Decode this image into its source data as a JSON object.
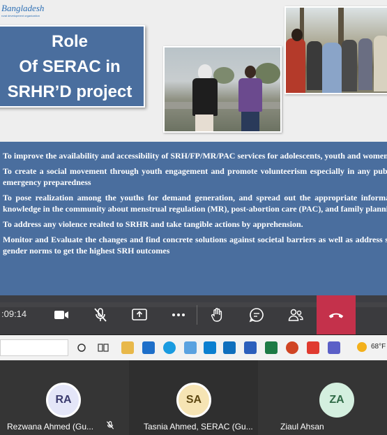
{
  "slide": {
    "logo_text": "Bangladesh",
    "logo_subtext": "rural development organization",
    "title_lines": [
      "Role",
      "Of SERAC in",
      "SRHR’D project"
    ],
    "bullets": [
      "To improve the availability and accessibility of SRH/FP/MR/PAC services for adolescents, youth and women",
      "To create a social movement through youth engagement and promote volunteerism especially in any public health emergency preparedness",
      "To pose realization among the youths for demand generation, and spread out the appropriate information and knowledge in the community about menstrual regulation (MR), post-abortion care (PAC), and family planning (FP)",
      "To address any violence realted to SRHR and take tangible actions by apprehension.",
      "Monitor and Evaluate the changes and find concrete solutions against societal barriers as well as address social and gender norms to get the highest SRH outcomes"
    ]
  },
  "controls": {
    "timer": ":09:14",
    "buttons": [
      "camera-icon",
      "mic-muted-icon",
      "share-icon",
      "more-icon",
      "raise-hand-icon",
      "chat-icon",
      "participants-icon",
      "hang-up-icon"
    ],
    "hangup_color": "#c4314b"
  },
  "taskbar": {
    "temperature": "68°F"
  },
  "participants": [
    {
      "initials": "RA",
      "name": "Rezwana Ahmed (Gu...",
      "muted": true
    },
    {
      "initials": "SA",
      "name": "Tasnia Ahmed, SERAC (Gu...",
      "muted": false
    },
    {
      "initials": "ZA",
      "name": "Ziaul Ahsan",
      "muted": false
    }
  ],
  "colors": {
    "slide_accent": "#4a6e9e",
    "toolbar_bg": "#3c3c40"
  }
}
